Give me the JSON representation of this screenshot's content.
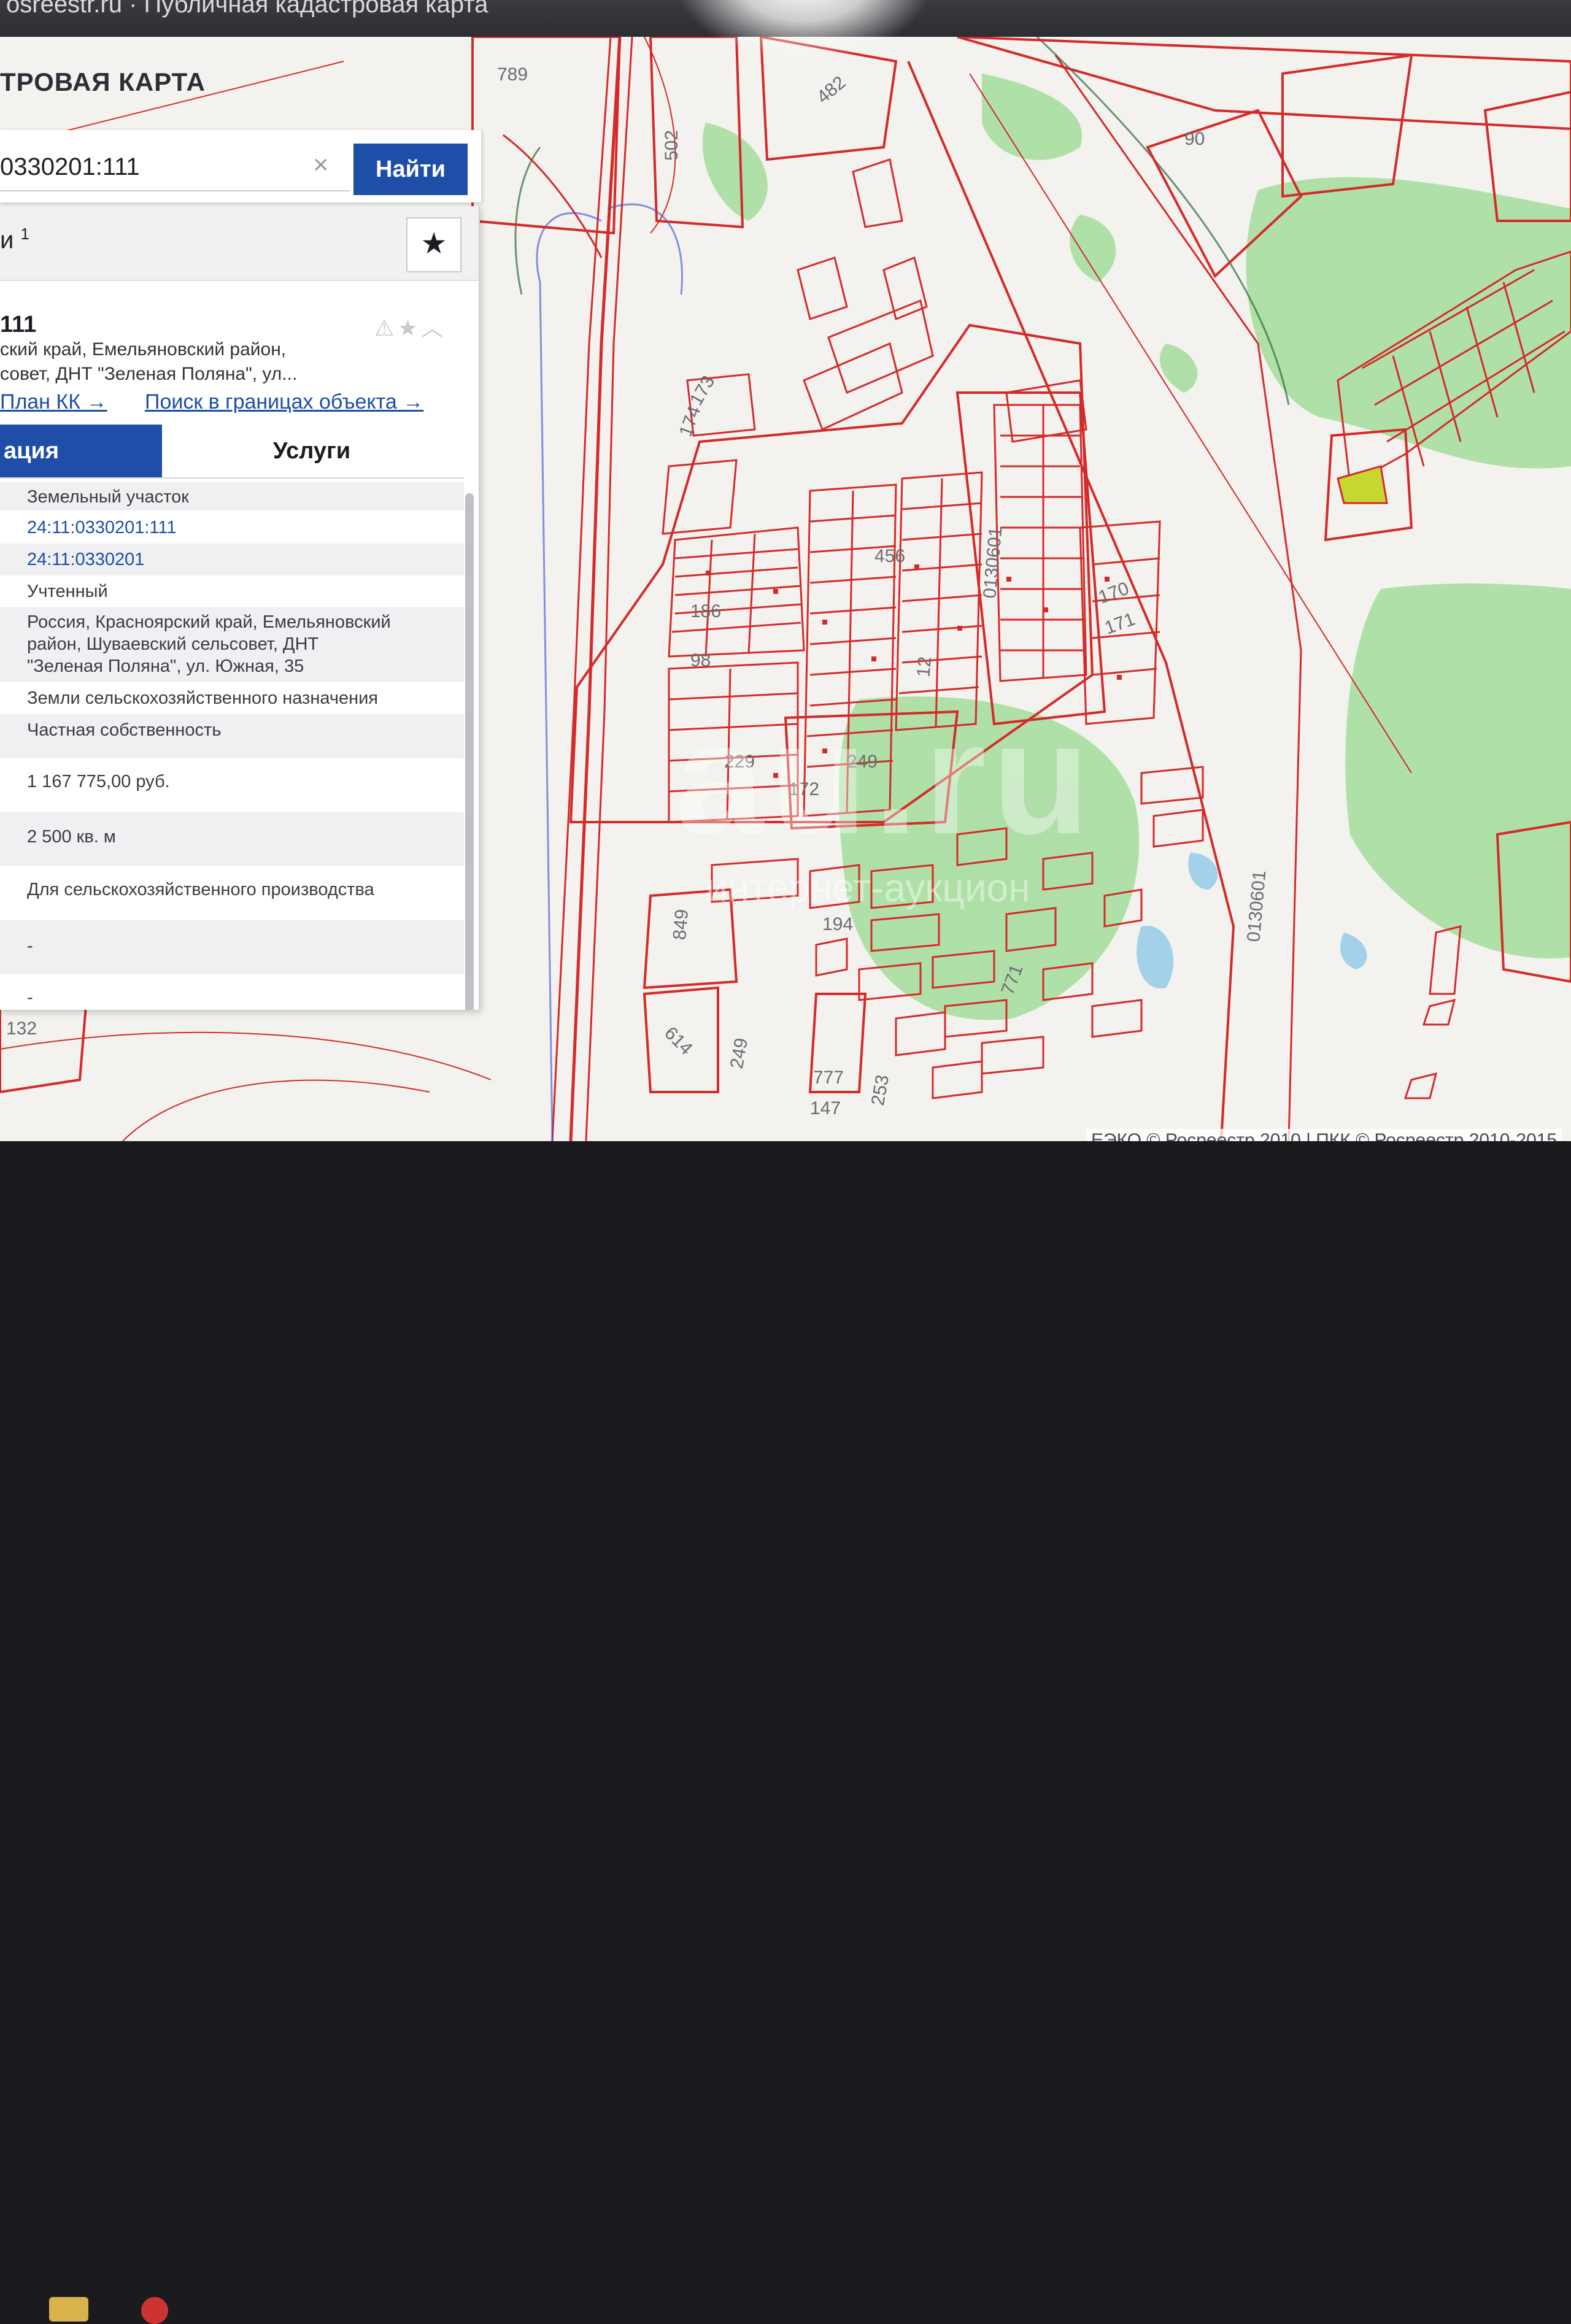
{
  "browser": {
    "title": "osreestr.ru · Публичная кадастровая карта"
  },
  "header": {
    "title": "ТРОВАЯ КАРТА"
  },
  "search": {
    "value": "0330201:111",
    "clear_icon": "×",
    "button_label": "Найти"
  },
  "results": {
    "label": "и",
    "count": "1",
    "star_icon": "★"
  },
  "object": {
    "number": "111",
    "address_line1": "ский край, Емельяновский район,",
    "address_line2": "совет, ДНТ \"Зеленая Поляна\", ул...",
    "icons": "⚠★︿",
    "link_plan": "План КК →",
    "link_search": "Поиск в границах объекта →"
  },
  "tabs": {
    "info": "ация",
    "services": "Услуги"
  },
  "details": [
    {
      "value": "Земельный участок",
      "link": false
    },
    {
      "value": "24:11:0330201:111",
      "link": true
    },
    {
      "value": "24:11:0330201",
      "link": true
    },
    {
      "value": "Учтенный",
      "link": false
    },
    {
      "value": "Россия, Красноярский край, Емельяновский",
      "link": false
    },
    {
      "value": "район, Шуваевский сельсовет, ДНТ",
      "link": false
    },
    {
      "value": "\"Зеленая Поляна\", ул. Южная, 35",
      "link": false
    },
    {
      "value": "Земли сельскохозяйственного назначения",
      "link": false
    },
    {
      "value": "Частная собственность",
      "link": false
    },
    {
      "value": "1 167 775,00 руб.",
      "link": false
    },
    {
      "value": "2 500 кв. м",
      "link": false
    },
    {
      "value": "Для сельскохозяйственного производства",
      "link": false
    },
    {
      "value": "-",
      "link": false
    },
    {
      "value": "-",
      "link": false
    }
  ],
  "map": {
    "labels": [
      "789",
      "502",
      "482",
      "90",
      "173",
      "174",
      "456",
      "0130601",
      "186",
      "98",
      "12",
      "229",
      "249",
      "172",
      "170",
      "171",
      "194",
      "849",
      "614",
      "249",
      "777",
      "147",
      "253",
      "132",
      "0130601",
      "771"
    ],
    "copyright": "ЕЭКО © Росреестр 2010 | ПКК © Росреестр 2010-2015",
    "watermark_main": "au.ru",
    "watermark_sub": "интернет-аукцион"
  },
  "colors": {
    "parcel": "#d42a2a",
    "accent": "#1e4ea8",
    "green": "#8fd58b",
    "map_bg": "#f3f2ee"
  }
}
